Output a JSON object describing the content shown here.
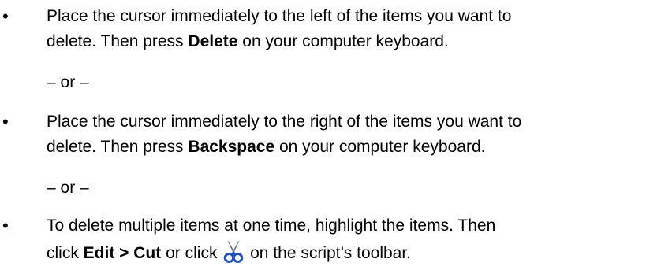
{
  "items": [
    {
      "bullet": "•",
      "line1": "Place the cursor immediately to the left of the items you want to",
      "line2_pre": "delete. Then press ",
      "line2_bold": "Delete",
      "line2_post": " on your computer keyboard."
    },
    {
      "bullet": "•",
      "line1": "Place the cursor immediately to the right of the items you want to",
      "line2_pre": "delete. Then press ",
      "line2_bold": "Backspace",
      "line2_post": " on your computer keyboard."
    },
    {
      "bullet": "•",
      "line1": "To delete multiple items at one time, highlight the items. Then",
      "line2_pre": "click ",
      "line2_bold": "Edit > Cut",
      "line2_mid": " or click ",
      "line2_post": " on the script’s toolbar.",
      "icon": "scissors-icon"
    }
  ],
  "separator": "– or –"
}
